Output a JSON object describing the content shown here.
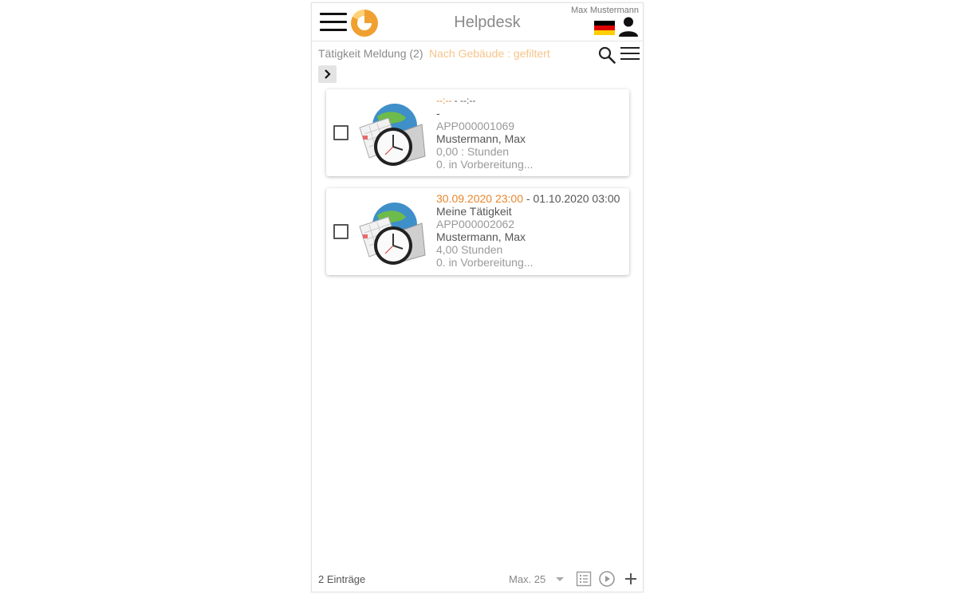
{
  "header": {
    "title": "Helpdesk",
    "user_name": "Max Mustermann",
    "menu_icon": "hamburger-icon",
    "language_icon": "flag-de-icon",
    "user_icon": "person-icon"
  },
  "toolbar": {
    "breadcrumb": "Tätigkeit Meldung (2)",
    "filter": "Nach Gebäude : gefiltert",
    "search_icon": "search-icon",
    "list_menu_icon": "list-menu-icon",
    "expand_icon": "chevron-right-icon"
  },
  "records": [
    {
      "start": "--:--",
      "separator": " - ",
      "end": "--:--",
      "title": "-",
      "id": "APP000001069",
      "person": "Mustermann, Max",
      "hours": "0,00 : Stunden",
      "status": "0. in Vorbereitung...",
      "checked": false
    },
    {
      "start": "30.09.2020 23:00",
      "separator": " - ",
      "end": "01.10.2020 03:00",
      "title": "Meine Tätigkeit",
      "id": "APP000002062",
      "person": "Mustermann, Max",
      "hours": "4,00 Stunden",
      "status": "0. in Vorbereitung...",
      "checked": false
    }
  ],
  "footer": {
    "count": "2 Einträge",
    "max": "Max. 25",
    "icons": [
      "list-view-icon",
      "play-circle-icon",
      "add-icon"
    ]
  },
  "colors": {
    "accent_orange": "#e8852b",
    "filter_orange": "#f6c48a",
    "text_grey": "#999999"
  }
}
